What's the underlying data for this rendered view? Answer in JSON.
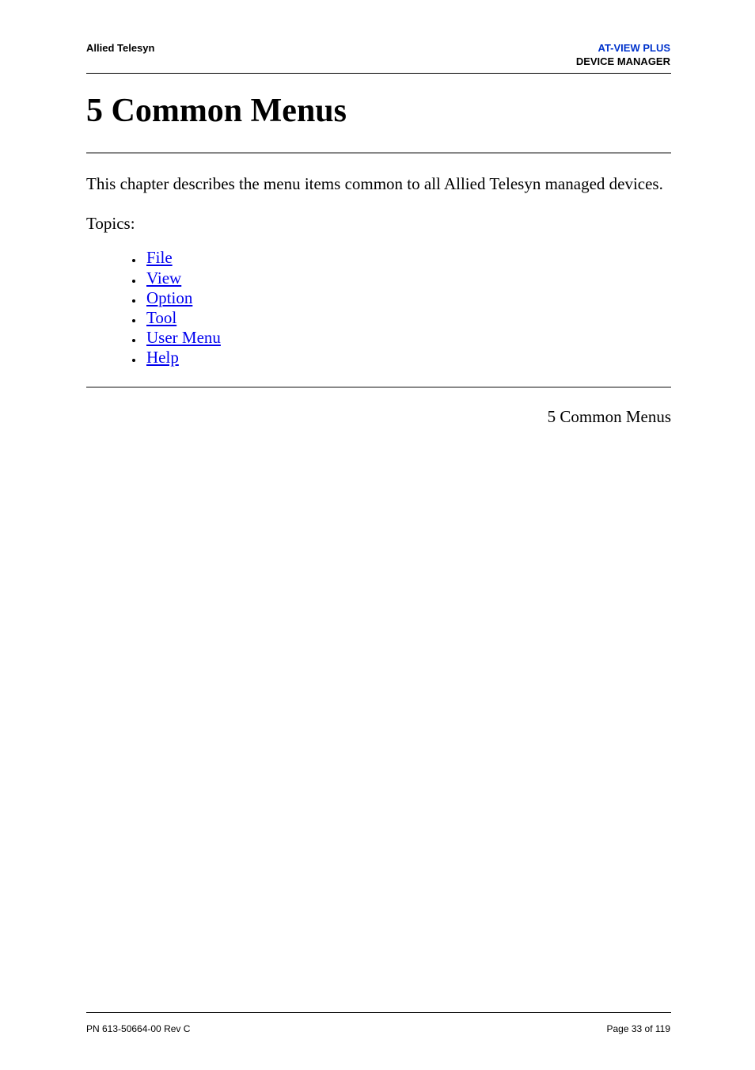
{
  "header": {
    "left": "Allied Telesyn",
    "right_line1": "AT-VIEW PLUS",
    "right_line2": "DEVICE MANAGER"
  },
  "title": "5 Common Menus",
  "intro": "This chapter describes the menu items common to all Allied Telesyn managed devices.",
  "topics_label": "Topics:",
  "links": [
    {
      "label": "File"
    },
    {
      "label": "View"
    },
    {
      "label": "Option"
    },
    {
      "label": "Tool"
    },
    {
      "label": "User Menu"
    },
    {
      "label": "Help"
    }
  ],
  "breadcrumb": "5 Common Menus",
  "footer": {
    "left": "PN 613-50664-00 Rev C",
    "right": "Page 33 of 119"
  }
}
